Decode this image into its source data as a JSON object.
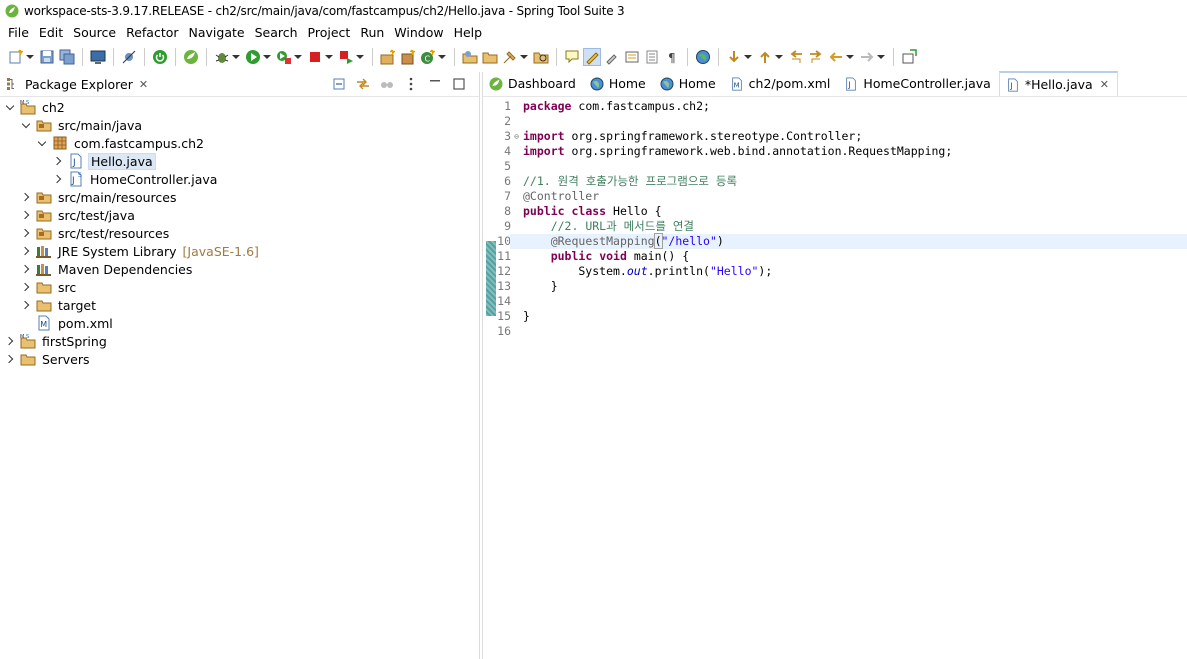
{
  "window": {
    "title": "workspace-sts-3.9.17.RELEASE - ch2/src/main/java/com/fastcampus/ch2/Hello.java - Spring Tool Suite 3"
  },
  "menu": [
    "File",
    "Edit",
    "Source",
    "Refactor",
    "Navigate",
    "Search",
    "Project",
    "Run",
    "Window",
    "Help"
  ],
  "package_explorer": {
    "tab_label": "Package Explorer",
    "tree": [
      {
        "label": "ch2",
        "indent": 0,
        "twist": "open",
        "icon": "project-icon"
      },
      {
        "label": "src/main/java",
        "indent": 1,
        "twist": "open",
        "icon": "source-folder-icon"
      },
      {
        "label": "com.fastcampus.ch2",
        "indent": 2,
        "twist": "open",
        "icon": "package-icon"
      },
      {
        "label": "Hello.java",
        "indent": 3,
        "twist": "closed",
        "icon": "java-file-icon",
        "selected": true
      },
      {
        "label": "HomeController.java",
        "indent": 3,
        "twist": "closed",
        "icon": "spring-java-file-icon"
      },
      {
        "label": "src/main/resources",
        "indent": 1,
        "twist": "closed",
        "icon": "source-folder-icon"
      },
      {
        "label": "src/test/java",
        "indent": 1,
        "twist": "closed",
        "icon": "source-folder-icon"
      },
      {
        "label": "src/test/resources",
        "indent": 1,
        "twist": "closed",
        "icon": "source-folder-icon"
      },
      {
        "label": "JRE System Library",
        "decor": "[JavaSE-1.6]",
        "indent": 1,
        "twist": "closed",
        "icon": "library-icon"
      },
      {
        "label": "Maven Dependencies",
        "indent": 1,
        "twist": "closed",
        "icon": "library-icon"
      },
      {
        "label": "src",
        "indent": 1,
        "twist": "closed",
        "icon": "folder-icon"
      },
      {
        "label": "target",
        "indent": 1,
        "twist": "closed",
        "icon": "folder-icon"
      },
      {
        "label": "pom.xml",
        "indent": 1,
        "twist": "none",
        "icon": "maven-file-icon"
      },
      {
        "label": "firstSpring",
        "indent": 0,
        "twist": "closed",
        "icon": "project-icon"
      },
      {
        "label": "Servers",
        "indent": 0,
        "twist": "closed",
        "icon": "folder-icon"
      }
    ]
  },
  "editor_tabs": [
    {
      "label": "Dashboard",
      "icon": "spring-icon"
    },
    {
      "label": "Home",
      "icon": "globe-icon"
    },
    {
      "label": "Home",
      "icon": "globe-icon"
    },
    {
      "label": "ch2/pom.xml",
      "icon": "maven-file-icon"
    },
    {
      "label": "HomeController.java",
      "icon": "java-file-icon"
    },
    {
      "label": "*Hello.java",
      "icon": "java-file-icon",
      "active": true
    }
  ],
  "code": {
    "line_numbers": [
      "1",
      "2",
      "3",
      "4",
      "5",
      "6",
      "7",
      "8",
      "9",
      "10",
      "11",
      "12",
      "13",
      "14",
      "15",
      "16"
    ],
    "lines": [
      [
        {
          "t": "package",
          "c": "kw"
        },
        {
          "t": " com.fastcampus.ch2;"
        }
      ],
      [],
      [
        {
          "t": "import",
          "c": "kw"
        },
        {
          "t": " org.springframework.stereotype.Controller;"
        }
      ],
      [
        {
          "t": "import",
          "c": "kw"
        },
        {
          "t": " org.springframework.web.bind.annotation.RequestMapping;"
        }
      ],
      [],
      [
        {
          "t": "//1. 원격 호출가능한 프로그램으로 등록",
          "c": "cm"
        }
      ],
      [
        {
          "t": "@Controller",
          "c": "an"
        }
      ],
      [
        {
          "t": "public",
          "c": "kw"
        },
        {
          "t": " "
        },
        {
          "t": "class",
          "c": "kw"
        },
        {
          "t": " Hello {"
        }
      ],
      [
        {
          "t": "    "
        },
        {
          "t": "//2. URL과 메서드를 연결",
          "c": "cm"
        }
      ],
      [
        {
          "t": "    "
        },
        {
          "t": "@RequestMapping",
          "c": "an"
        },
        {
          "t": "(",
          "c": "bracket"
        },
        {
          "t": "\"/hello\"",
          "c": "st"
        },
        {
          "t": ")"
        }
      ],
      [
        {
          "t": "    "
        },
        {
          "t": "public",
          "c": "kw"
        },
        {
          "t": " "
        },
        {
          "t": "void",
          "c": "kw"
        },
        {
          "t": " main() {"
        }
      ],
      [
        {
          "t": "        System."
        },
        {
          "t": "out",
          "c": "fi"
        },
        {
          "t": ".println("
        },
        {
          "t": "\"Hello\"",
          "c": "st"
        },
        {
          "t": ");"
        }
      ],
      [
        {
          "t": "    }"
        }
      ],
      [],
      [
        {
          "t": "}"
        }
      ],
      []
    ],
    "fold_lines": [
      3,
      10
    ],
    "current_line": 10
  }
}
